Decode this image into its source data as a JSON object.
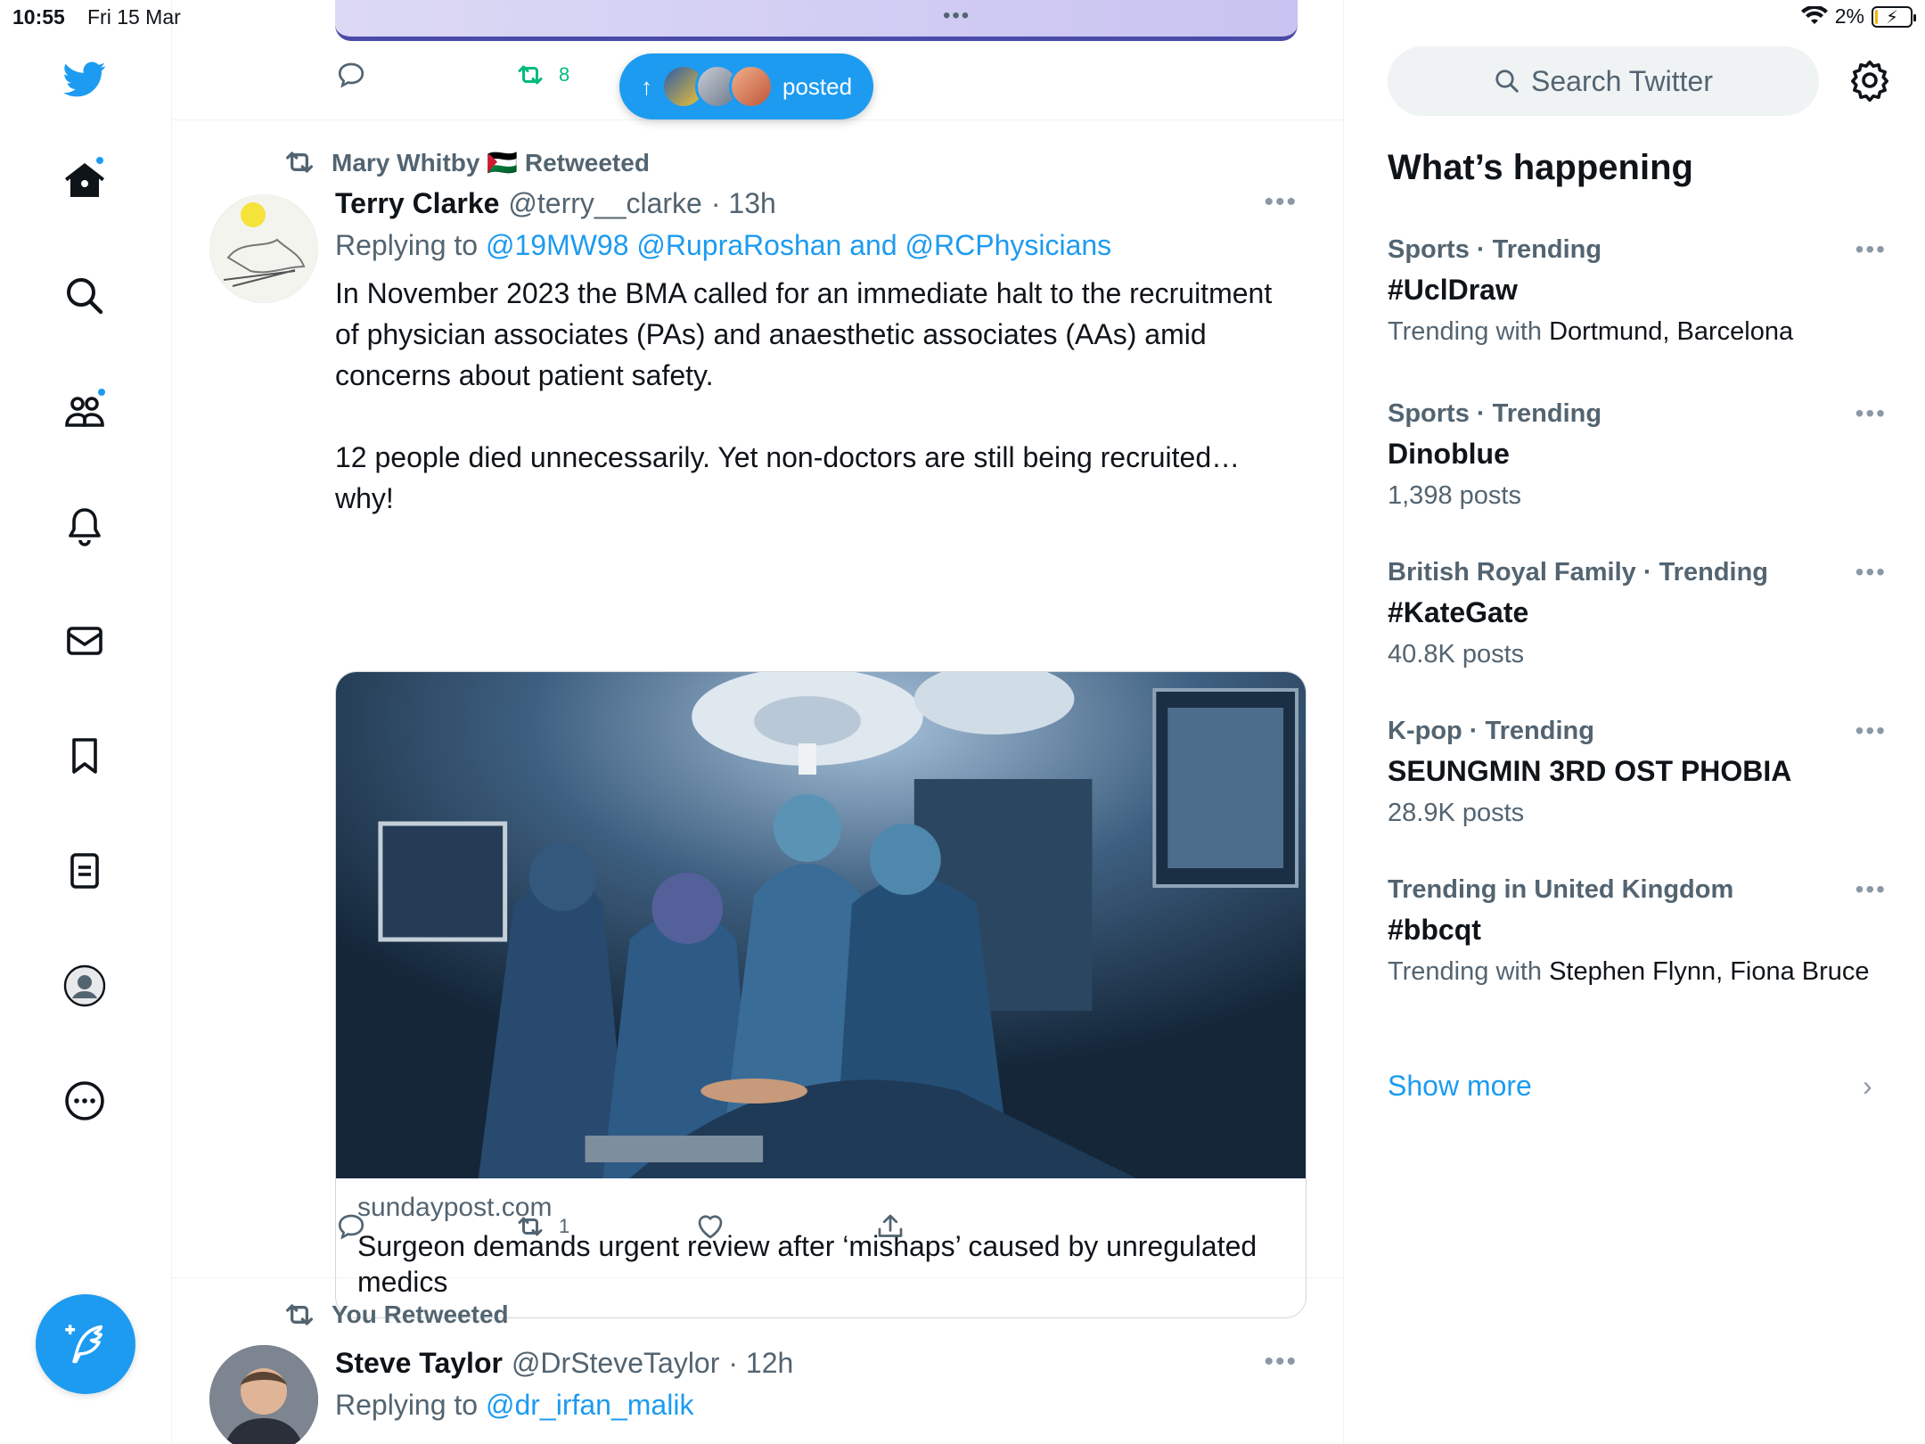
{
  "status_bar": {
    "time": "10:55",
    "date": "Fri 15 Mar",
    "battery": "2%",
    "battery_level": 0.02
  },
  "nav": {
    "items": [
      {
        "icon": "twitter-logo-icon"
      },
      {
        "icon": "home-icon",
        "badge": true
      },
      {
        "icon": "search-icon"
      },
      {
        "icon": "communities-icon",
        "badge": true
      },
      {
        "icon": "notifications-bell-icon"
      },
      {
        "icon": "messages-envelope-icon"
      },
      {
        "icon": "bookmark-icon"
      },
      {
        "icon": "lists-icon"
      },
      {
        "icon": "profile-avatar-icon"
      },
      {
        "icon": "more-circle-icon"
      }
    ],
    "compose_icon": "compose-feather-icon",
    "accent": "#1d9bf0"
  },
  "top_tweet_actions": {
    "retweet_count": "8",
    "accent_retweet": "#00ba7c"
  },
  "posted_pill": {
    "label": "posted"
  },
  "tweet1": {
    "retweeted_by": "Mary Whitby 🇵🇸 Retweeted",
    "name": "Terry Clarke",
    "handle": "@terry__clarke",
    "time": "· 13h",
    "reply_prefix": "Replying to",
    "reply_targets": "@19MW98 @RupraRoshan and @RCPhysicians",
    "text": "In November 2023 the BMA called for an immediate halt to the recruitment of physician associates (PAs) and anaesthetic associates (AAs) amid concerns about patient safety.\n\n12 people died unnecessarily. Yet non-doctors are still being recruited… why!",
    "card_domain": "sundaypost.com",
    "card_title": "Surgeon demands urgent review after ‘mishaps’ caused by unregulated medics",
    "retweet_count": "1"
  },
  "tweet2": {
    "retweeted_by": "You Retweeted",
    "name": "Steve Taylor",
    "handle": "@DrSteveTaylor",
    "time": "· 12h",
    "reply_prefix": "Replying to",
    "reply_targets": "@dr_irfan_malik"
  },
  "sidebar": {
    "search_placeholder": "Search Twitter",
    "heading": "What’s happening",
    "trends": [
      {
        "meta": "Sports · Trending",
        "title": "#UclDraw",
        "sub_prefix": "Trending with",
        "sub_value": "Dortmund, Barcelona"
      },
      {
        "meta": "Sports · Trending",
        "title": "Dinoblue",
        "sub_prefix": "1,398 posts",
        "sub_value": ""
      },
      {
        "meta": "British Royal Family · Trending",
        "title": "#KateGate",
        "sub_prefix": "40.8K posts",
        "sub_value": ""
      },
      {
        "meta": "K-pop · Trending",
        "title": "SEUNGMIN 3RD OST PHOBIA",
        "sub_prefix": "28.9K posts",
        "sub_value": ""
      },
      {
        "meta": "Trending in United Kingdom",
        "title": "#bbcqt",
        "sub_prefix": "Trending with",
        "sub_value": "Stephen Flynn, Fiona Bruce"
      }
    ],
    "show_more": "Show more"
  }
}
